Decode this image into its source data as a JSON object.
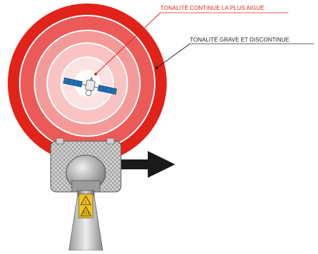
{
  "labels": {
    "continuous_high_tone": "TONALITÉ CONTINUE LA PLUS AIGUË",
    "low_discontinuous_tone": "TONALITÉ GRAVE ET DISCONTINUE"
  },
  "colors": {
    "accent_red": "#e2231a",
    "ring_light": "#ffffff",
    "arrow": "#1a1a1a",
    "device_body": "#bdbdbd",
    "warning_label": "#f2c21b"
  },
  "icons": [
    "satellite-icon",
    "warning-triangle-icon",
    "hot-surface-icon",
    "direction-arrow-icon"
  ]
}
